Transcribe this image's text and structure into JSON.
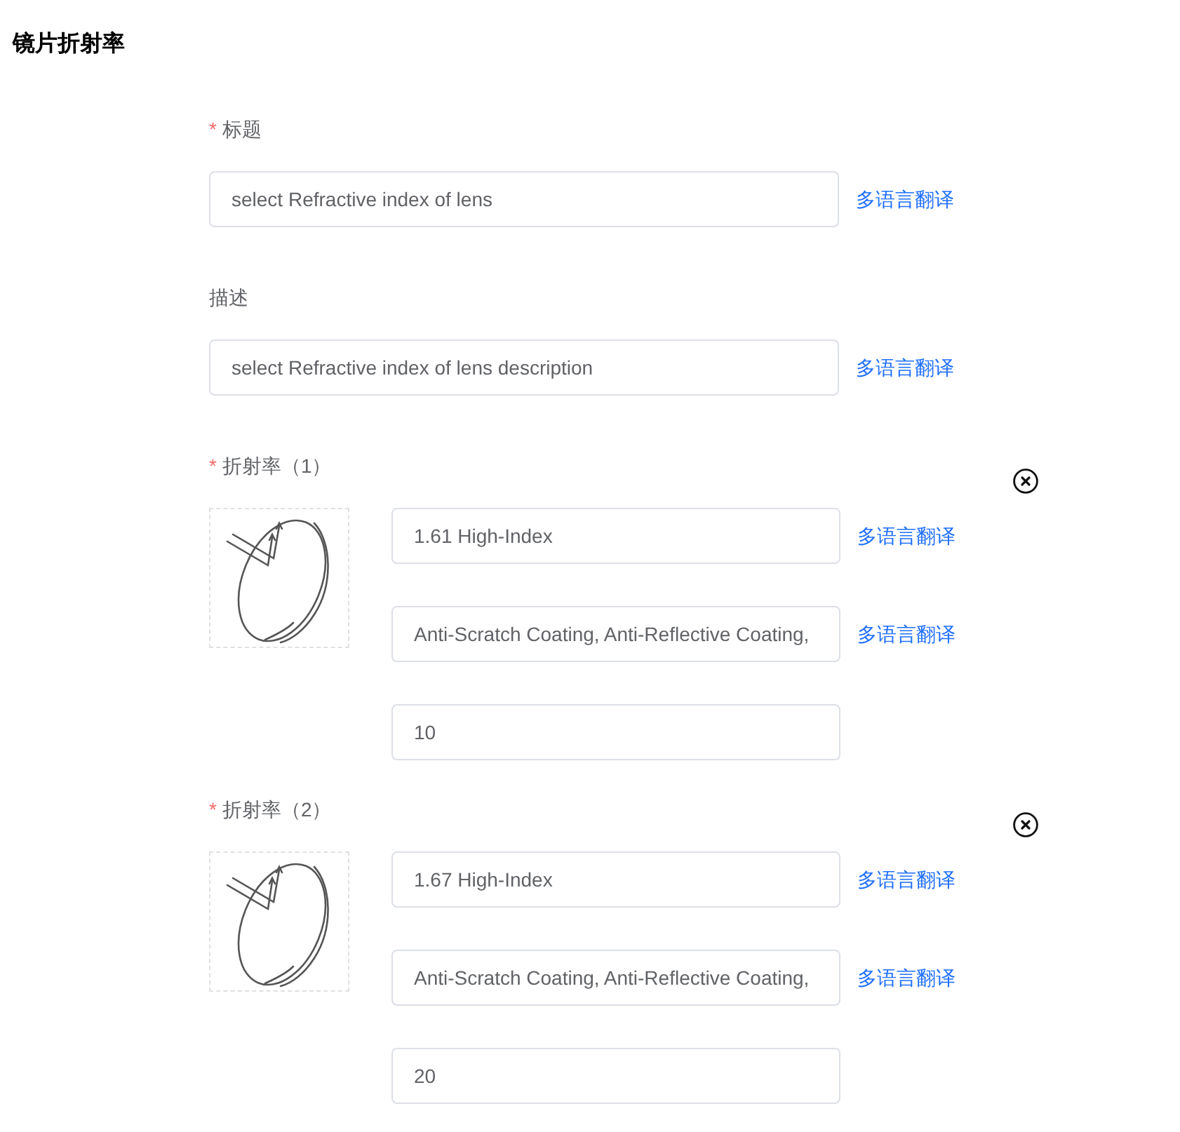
{
  "page_title": "镜片折射率",
  "fields": [
    {
      "required_mark": "*",
      "label": "标题",
      "value": "select Refractive index of lens",
      "action": "多语言翻译"
    },
    {
      "label": "描述",
      "value": "select Refractive index of lens description",
      "action": "多语言翻译"
    }
  ],
  "refractive_options": [
    {
      "required_mark": "*",
      "label": "折射率（1）",
      "inputs": [
        {
          "value": "1.61 High-Index",
          "action": "多语言翻译"
        },
        {
          "value": "Anti-Scratch Coating, Anti-Reflective Coating,",
          "action": "多语言翻译"
        },
        {
          "value": "10"
        }
      ]
    },
    {
      "required_mark": "*",
      "label": "折射率（2）",
      "inputs": [
        {
          "value": "1.67 High-Index",
          "action": "多语言翻译"
        },
        {
          "value": "Anti-Scratch Coating, Anti-Reflective Coating,",
          "action": "多语言翻译"
        },
        {
          "value": "20"
        }
      ]
    }
  ]
}
